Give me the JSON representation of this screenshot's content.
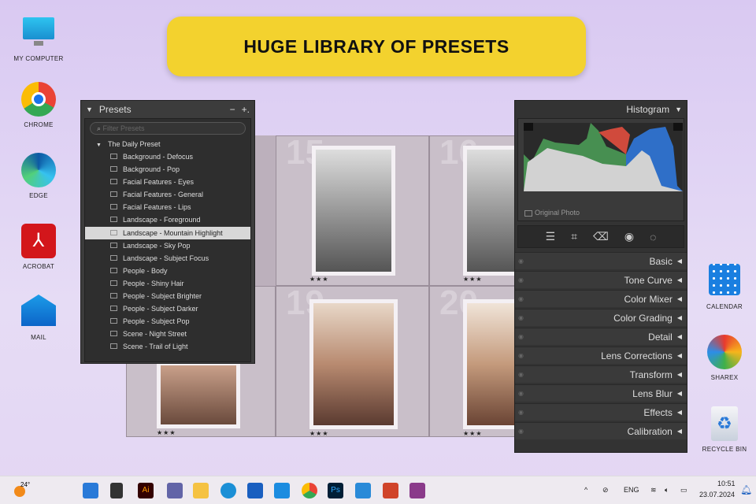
{
  "banner": "HUGE LIBRARY OF PRESETS",
  "desktop_left": [
    "MY COMPUTER",
    "CHROME",
    "EDGE",
    "ACROBAT",
    "MAIL"
  ],
  "desktop_right": [
    "CALENDAR",
    "SHAREX",
    "RECYCLE BIN"
  ],
  "presets": {
    "title": "Presets",
    "minus": "−",
    "plus": "+.",
    "filter_placeholder": "Filter Presets",
    "group": "The Daily Preset",
    "items": [
      "Background - Defocus",
      "Background - Pop",
      "Facial Features - Eyes",
      "Facial Features - General",
      "Facial Features - Lips",
      "Landscape - Foreground",
      "Landscape - Mountain Highlight",
      "Landscape - Sky Pop",
      "Landscape - Subject Focus",
      "People - Body",
      "People - Shiny Hair",
      "People - Subject Brighter",
      "People - Subject Darker",
      "People - Subject Pop",
      "Scene - Night Street",
      "Scene - Trail of Light"
    ],
    "selected": "Landscape - Mountain Highlight"
  },
  "grid": {
    "cells": [
      {
        "num": "15",
        "stars": "★★★"
      },
      {
        "num": "16",
        "stars": "★★★"
      },
      {
        "num": "19",
        "stars": "★★★"
      },
      {
        "num": "20",
        "stars": "★★★"
      }
    ],
    "left_stars": "★★★"
  },
  "develop": {
    "histogram_title": "Histogram",
    "original_photo": "Original Photo",
    "sections": [
      "Basic",
      "Tone Curve",
      "Color Mixer",
      "Color Grading",
      "Detail",
      "Lens Corrections",
      "Transform",
      "Lens Blur",
      "Effects",
      "Calibration"
    ]
  },
  "taskbar": {
    "weather": "24°",
    "lang": "ENG",
    "time": "10:51",
    "date": "23.07.2024"
  }
}
